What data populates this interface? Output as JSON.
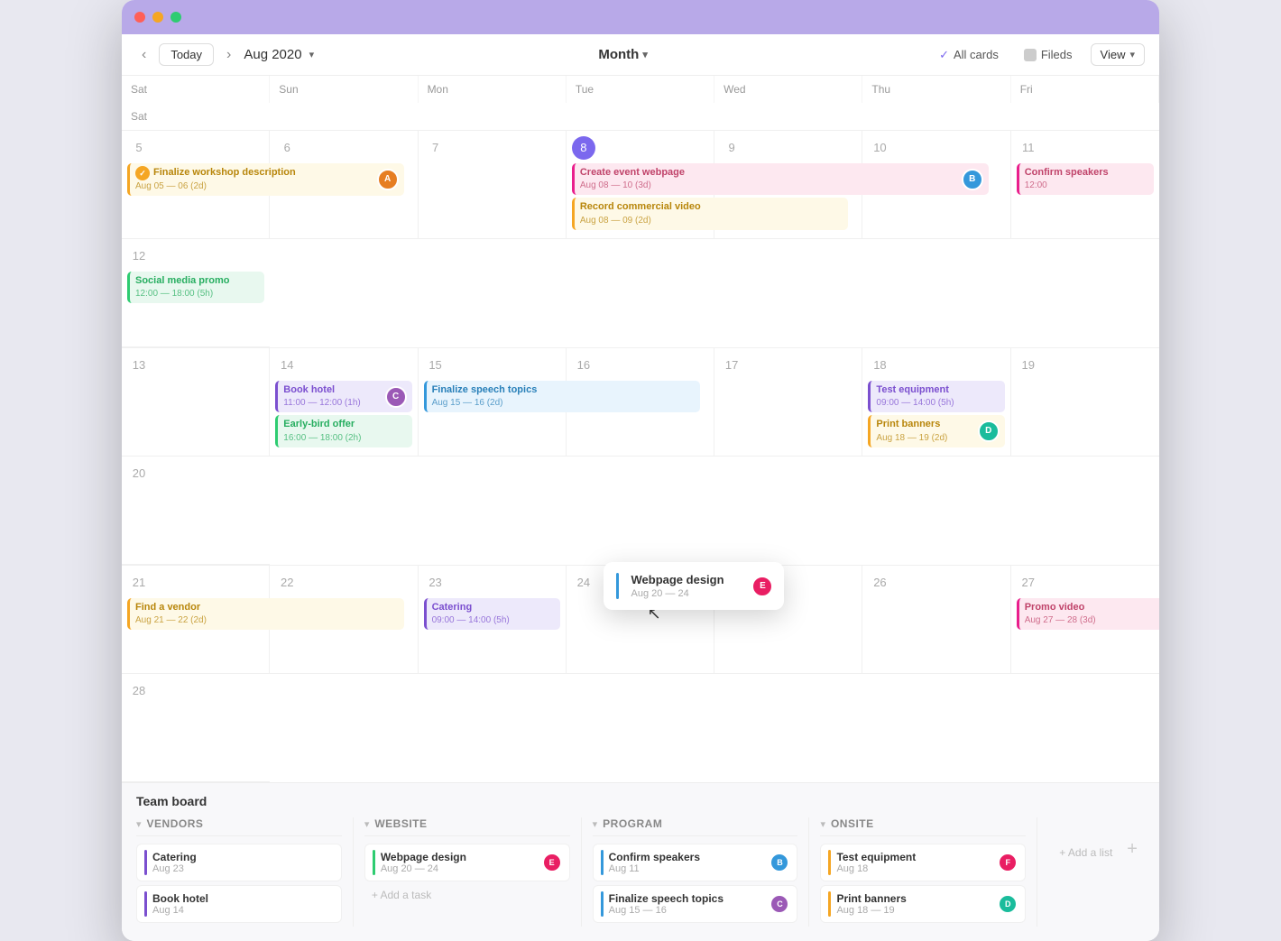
{
  "window": {
    "titlebar_dots": [
      "red",
      "yellow",
      "green"
    ]
  },
  "toolbar": {
    "nav_prev": "‹",
    "nav_next": "›",
    "today_label": "Today",
    "month_label": "Aug 2020",
    "view_label": "Month",
    "all_cards_label": "All cards",
    "fileds_label": "Fileds",
    "view_label2": "View"
  },
  "calendar": {
    "days": [
      "Sat",
      "Sun",
      "Mon",
      "Tue",
      "Wed",
      "Thu",
      "Fri",
      "Sat"
    ],
    "weeks": [
      {
        "dates": [
          "5",
          "6",
          "7",
          "8",
          "9",
          "10",
          "11",
          "12"
        ],
        "events": {
          "sat5": {
            "span": "Finalize workshop description",
            "span_sub": "Aug 05 — 06 (2d)",
            "color": "yellow",
            "has_avatar": true,
            "has_check": true
          },
          "tue8": [
            {
              "title": "Create event webpage",
              "sub": "Aug 08 — 10 (3d)",
              "color": "pink",
              "has_avatar": true
            },
            {
              "title": "Record commercial video",
              "sub": "Aug 08 — 09 (2d)",
              "color": "yellow"
            }
          ],
          "fri11": {
            "title": "Confirm speakers",
            "sub": "12:00",
            "color": "pink"
          },
          "sat12": {
            "title": "Social media promo",
            "sub": "12:00 — 18:00 (5h)",
            "color": "green"
          }
        }
      },
      {
        "dates": [
          "13",
          "14",
          "15",
          "16",
          "17",
          "18",
          "19",
          "20"
        ],
        "events": {
          "sun14": [
            {
              "title": "Book hotel",
              "sub": "11:00 — 12:00 (1h)",
              "color": "purple",
              "has_avatar": true
            },
            {
              "title": "Early-bird offer",
              "sub": "16:00 — 18:00 (2h)",
              "color": "green"
            }
          ],
          "mon15": {
            "span": "Finalize speech topics",
            "span_sub": "Aug 15 — 16 (2d)",
            "color": "blue"
          },
          "thu18": [
            {
              "title": "Test equipment",
              "sub": "09:00 — 14:00 (5h)",
              "color": "purple"
            },
            {
              "title": "Print banners",
              "sub": "Aug 18 — 19 (2d)",
              "color": "yellow",
              "has_avatar": true
            }
          ]
        }
      },
      {
        "dates": [
          "21",
          "22",
          "23",
          "24",
          "25",
          "26",
          "27",
          "28"
        ],
        "events": {
          "sat21": {
            "span": "Find a vendor",
            "span_sub": "Aug 21 — 22 (2d)",
            "color": "yellow"
          },
          "mon23": {
            "title": "Catering",
            "sub": "09:00 — 14:00 (5h)",
            "color": "purple"
          },
          "tue24_popup": true,
          "fri27": {
            "span": "Promo video",
            "span_sub": "Aug 27 — 28 (3d)",
            "color": "pink"
          }
        }
      }
    ]
  },
  "team_board": {
    "title": "Team board",
    "columns": [
      {
        "label": "Vendors",
        "tasks": [
          {
            "name": "Catering",
            "date": "Aug 23",
            "dot": "purple"
          },
          {
            "name": "Book hotel",
            "date": "Aug 14",
            "dot": "purple"
          }
        ],
        "add_task": false
      },
      {
        "label": "Website",
        "tasks": [
          {
            "name": "Webpage design",
            "date": "Aug 20 — 24",
            "dot": "green",
            "has_avatar": true
          }
        ],
        "add_task": true
      },
      {
        "label": "Program",
        "tasks": [
          {
            "name": "Confirm speakers",
            "date": "Aug 11",
            "dot": "blue",
            "has_avatar": true
          },
          {
            "name": "Finalize speech topics",
            "date": "Aug 15 — 16",
            "dot": "blue",
            "has_avatar": true
          }
        ],
        "add_task": false
      },
      {
        "label": "Onsite",
        "tasks": [
          {
            "name": "Test equipment",
            "date": "Aug 18",
            "dot": "yellow",
            "has_avatar": true
          },
          {
            "name": "Print banners",
            "date": "Aug 18 — 19",
            "dot": "yellow",
            "has_avatar": true
          }
        ],
        "add_task": false,
        "add_list": true
      }
    ]
  },
  "popup": {
    "title": "Webpage design",
    "date": "Aug 20 — 24"
  }
}
